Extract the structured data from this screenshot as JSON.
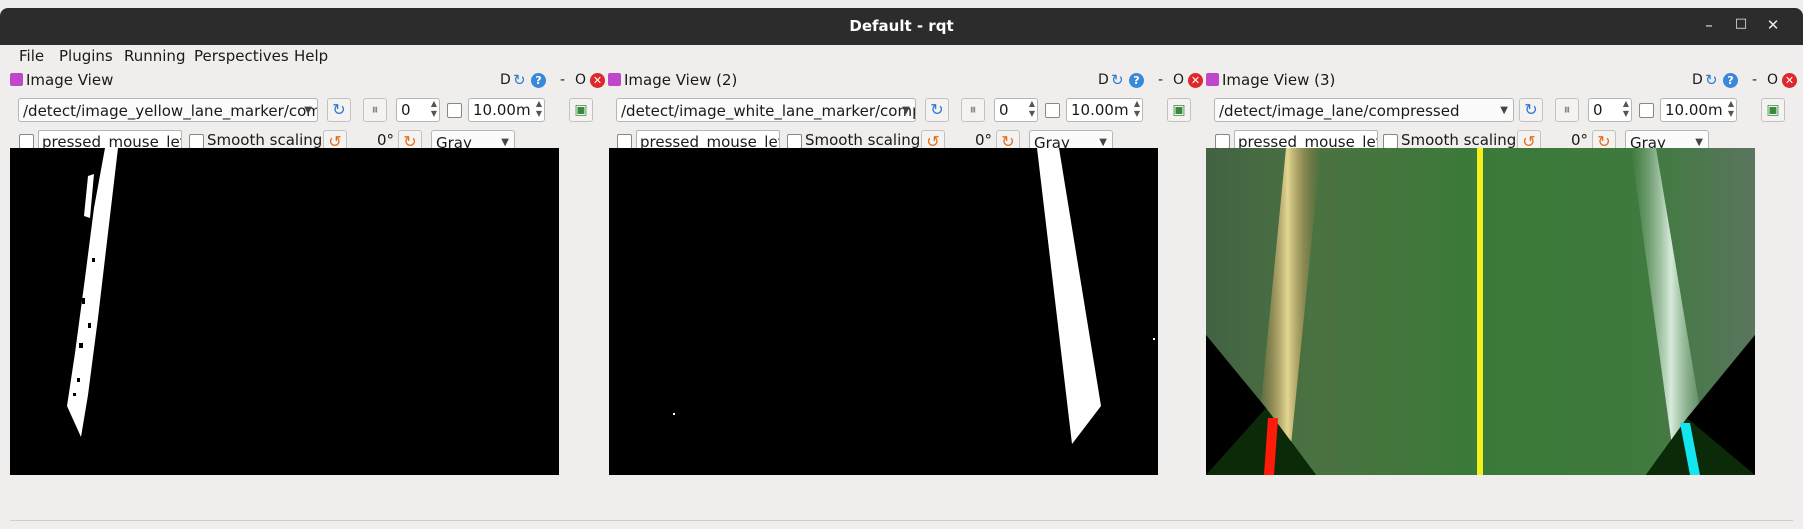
{
  "window": {
    "title": "Default - rqt",
    "minimize": "–",
    "maximize": "□",
    "close": "✕"
  },
  "menu": [
    "File",
    "Plugins",
    "Running",
    "Perspectives",
    "Help"
  ],
  "panels": [
    {
      "title": "Image View",
      "topic": "/detect/image_yellow_lane_marker/com",
      "spin_value": "0",
      "time_value": "10.00m",
      "mouse_topic": "pressed_mouse_left",
      "smooth_label": "Smooth scaling",
      "rotation": "0°",
      "color_mode": "Gray",
      "btn_d": "D",
      "btn_dash": "-",
      "btn_o": "O"
    },
    {
      "title": "Image View (2)",
      "topic": "/detect/image_white_lane_marker/comp",
      "spin_value": "0",
      "time_value": "10.00m",
      "mouse_topic": "pressed_mouse_left",
      "smooth_label": "Smooth scaling",
      "rotation": "0°",
      "color_mode": "Gray",
      "btn_d": "D",
      "btn_dash": "-",
      "btn_o": "O"
    },
    {
      "title": "Image View (3)",
      "topic": "/detect/image_lane/compressed",
      "spin_value": "0",
      "time_value": "10.00m",
      "mouse_topic": "pressed_mouse_left",
      "smooth_label": "Smooth scaling",
      "rotation": "0°",
      "color_mode": "Gray",
      "btn_d": "D",
      "btn_dash": "-",
      "btn_o": "O"
    }
  ],
  "colors": {
    "titlebar": "#2c2c2c",
    "close": "#e0272b",
    "help": "#3a88d8",
    "lane_yellow": "#f2f21a",
    "lane_cyan": "#14e6f0",
    "lane_red": "#ff1a0a"
  }
}
